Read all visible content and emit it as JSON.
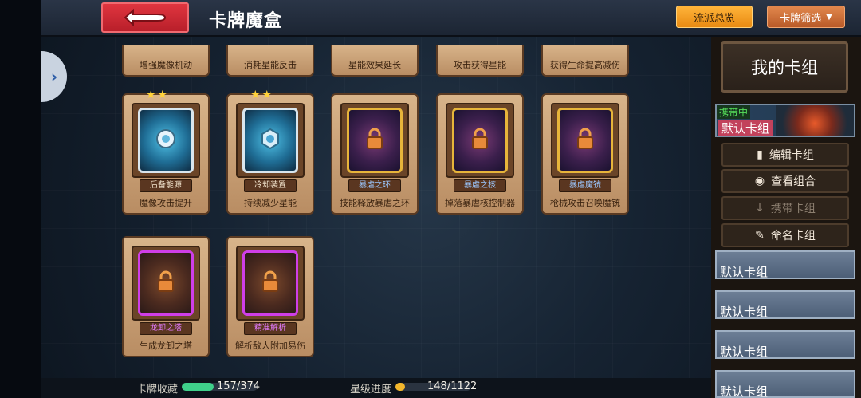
{
  "header": {
    "title": "卡牌魔盒",
    "school_overview": "流派总览",
    "card_filter": "卡牌筛选",
    "help": "?"
  },
  "cards_top_row": [
    {
      "caption": "增强魔像机动"
    },
    {
      "caption": "消耗星能反击"
    },
    {
      "caption": "星能效果延长"
    },
    {
      "caption": "攻击获得星能"
    },
    {
      "caption": "获得生命提高减伤"
    }
  ],
  "cards_row2": [
    {
      "label": "后备能源",
      "caption": "魔像攻击提升",
      "stars": "★★",
      "frame": "blue"
    },
    {
      "label": "冷却装置",
      "caption": "持续减少星能",
      "stars": "★★",
      "frame": "blue"
    },
    {
      "label": "暴虐之环",
      "caption": "技能释放暴虐之环",
      "stars": "",
      "frame": "gold"
    },
    {
      "label": "暴虐之核",
      "caption": "掉落暴虐核控制器",
      "stars": "",
      "frame": "gold"
    },
    {
      "label": "暴虐魔铳",
      "caption": "枪械攻击召唤魔铳",
      "stars": "",
      "frame": "gold"
    }
  ],
  "cards_row3": [
    {
      "label": "龙卸之塔",
      "caption": "生成龙卸之塔",
      "frame": "purple"
    },
    {
      "label": "精准解析",
      "caption": "解析敌人附加易伤",
      "frame": "purple"
    }
  ],
  "sidebar": {
    "my_deck": "我的卡组",
    "active_tag": "携带中",
    "active_deck": "默认卡组",
    "edit": "编辑卡组",
    "view": "查看组合",
    "carry": "携带卡组",
    "rename": "命名卡组",
    "slots": [
      "默认卡组",
      "默认卡组",
      "默认卡组",
      "默认卡组"
    ]
  },
  "footer": {
    "collection_label": "卡牌收藏",
    "collection_value": "157/374",
    "collection_progress": 0.42,
    "star_label": "星级进度",
    "star_value": "148/1122",
    "star_progress": 0.13
  },
  "colors": {
    "accent_orange": "#e88a12",
    "back_red": "#c8242f",
    "help_blue": "#1f5fc4",
    "collection_bar": "#3fd08a",
    "star_bar": "#f2b62c"
  }
}
